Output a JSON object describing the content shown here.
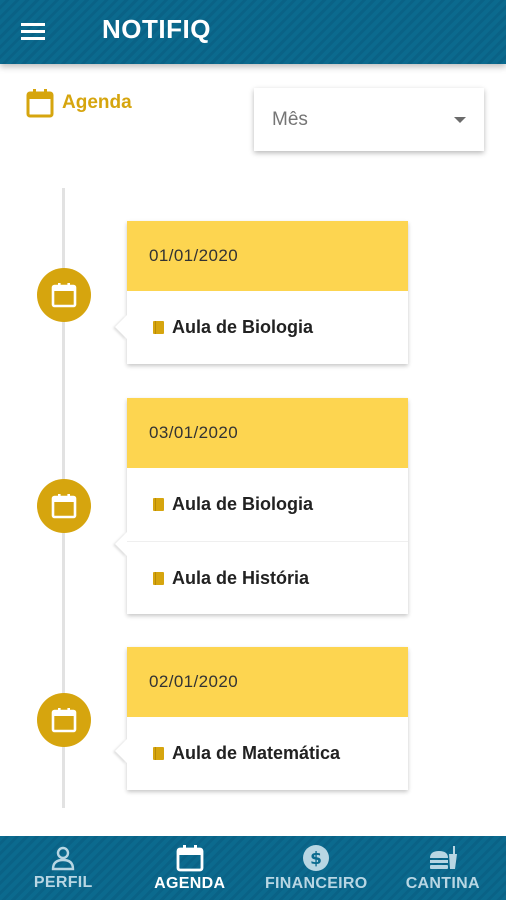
{
  "header": {
    "title": "NOTIFIQ",
    "menu_icon": "menu-icon"
  },
  "section": {
    "title": "Agenda",
    "icon": "calendar-icon"
  },
  "filter": {
    "value": "Mês",
    "icon": "chevron-down-icon"
  },
  "timeline": [
    {
      "date": "01/01/2020",
      "items": [
        "Aula de Biologia"
      ]
    },
    {
      "date": "03/01/2020",
      "items": [
        "Aula de Biologia",
        "Aula de História"
      ]
    },
    {
      "date": "02/01/2020",
      "items": [
        "Aula de Matemática"
      ]
    }
  ],
  "nav": [
    {
      "label": "PERFIL",
      "icon": "person-icon",
      "active": false
    },
    {
      "label": "AGENDA",
      "icon": "calendar-icon",
      "active": true
    },
    {
      "label": "FINANCEIRO",
      "icon": "dollar-coin-icon",
      "active": false
    },
    {
      "label": "CANTINA",
      "icon": "fastfood-icon",
      "active": false
    }
  ],
  "colors": {
    "primary": "#0b6a8e",
    "accent": "#d6a50e",
    "date_bg": "#fdd550"
  }
}
